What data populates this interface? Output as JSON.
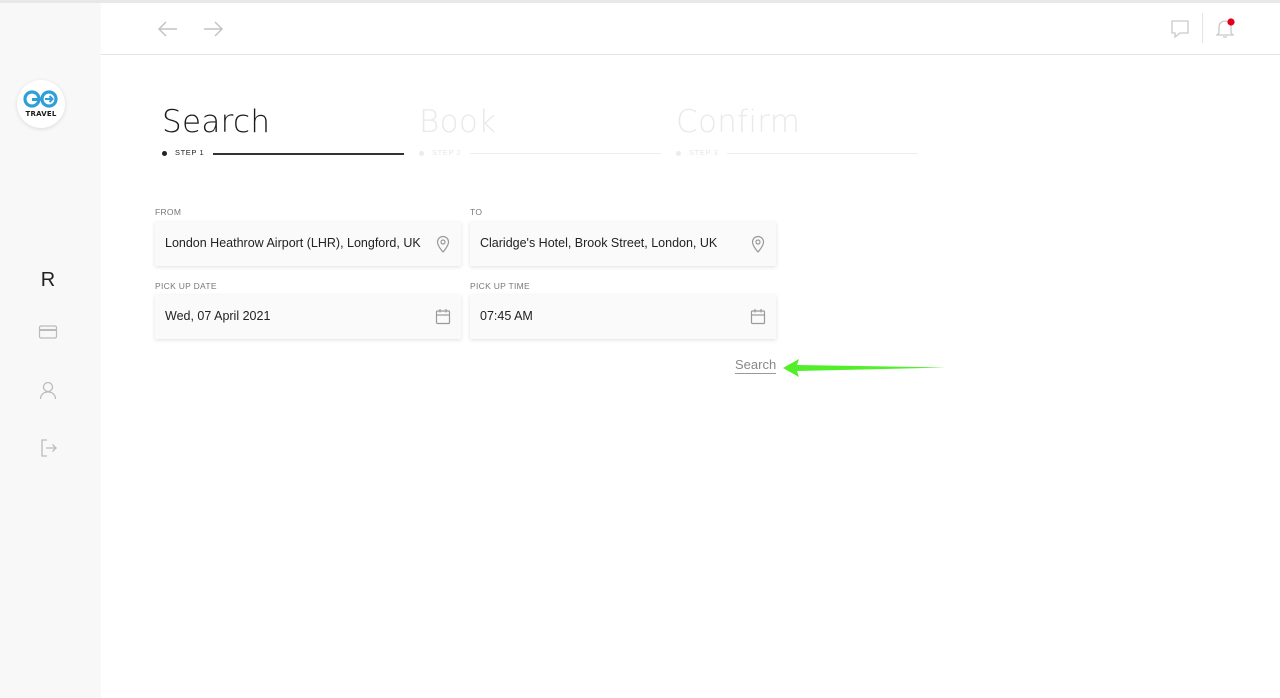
{
  "brand": {
    "logo_text": "TRAVEL"
  },
  "colors": {
    "accent": "#2e9fd8",
    "notification": "#e3001b",
    "annotation_arrow": "#52ee2a"
  },
  "sidebar": {
    "items": [
      {
        "label": "R",
        "icon": "r-initial"
      },
      {
        "icon": "credit-card-icon"
      },
      {
        "icon": "user-icon"
      },
      {
        "icon": "logout-icon"
      }
    ]
  },
  "topbar": {
    "back_icon": "arrow-left-icon",
    "forward_icon": "arrow-right-icon",
    "chat_icon": "chat-icon",
    "bell_icon": "bell-icon"
  },
  "steps": [
    {
      "title": "Search",
      "label": "STEP 1",
      "state": "active"
    },
    {
      "title": "Book",
      "label": "STEP 2",
      "state": "inactive"
    },
    {
      "title": "Confirm",
      "label": "STEP 3",
      "state": "inactive"
    }
  ],
  "form": {
    "from": {
      "label": "FROM",
      "value": "London Heathrow Airport (LHR), Longford, UK",
      "icon": "location-pin-icon"
    },
    "to": {
      "label": "TO",
      "value": "Claridge's Hotel, Brook Street, London, UK",
      "icon": "location-pin-icon"
    },
    "pickup_date": {
      "label": "PICK UP DATE",
      "value": "Wed, 07 April 2021",
      "icon": "calendar-icon"
    },
    "pickup_time": {
      "label": "PICK UP TIME",
      "value": "07:45 AM",
      "icon": "calendar-icon"
    },
    "search_label": "Search"
  }
}
